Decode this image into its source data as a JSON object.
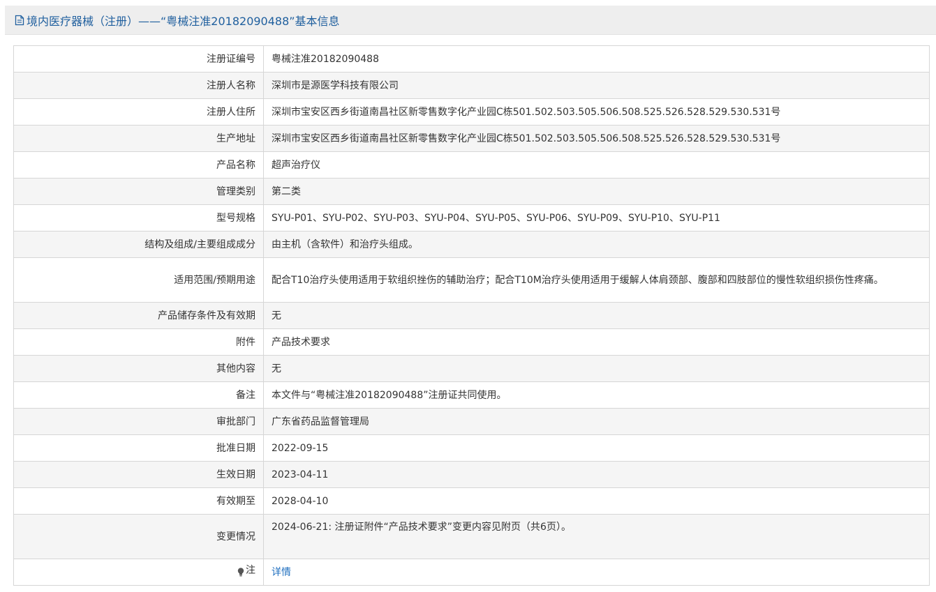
{
  "header": {
    "title": "境内医疗器械（注册）——“粤械注准20182090488”基本信息",
    "icon": "document-icon",
    "title_color": "#1f5f9e"
  },
  "rows": [
    {
      "label": "注册证编号",
      "value": "粤械注准20182090488"
    },
    {
      "label": "注册人名称",
      "value": "深圳市是源医学科技有限公司"
    },
    {
      "label": "注册人住所",
      "value": "深圳市宝安区西乡街道南昌社区新零售数字化产业园C栋501.502.503.505.506.508.525.526.528.529.530.531号"
    },
    {
      "label": "生产地址",
      "value": "深圳市宝安区西乡街道南昌社区新零售数字化产业园C栋501.502.503.505.506.508.525.526.528.529.530.531号"
    },
    {
      "label": "产品名称",
      "value": "超声治疗仪"
    },
    {
      "label": "管理类别",
      "value": "第二类"
    },
    {
      "label": "型号规格",
      "value": "SYU-P01、SYU-P02、SYU-P03、SYU-P04、SYU-P05、SYU-P06、SYU-P09、SYU-P10、SYU-P11"
    },
    {
      "label": "结构及组成/主要组成成分",
      "value": "由主机（含软件）和治疗头组成。"
    },
    {
      "label": "适用范围/预期用途",
      "value": "配合T10治疗头使用适用于软组织挫伤的辅助治疗；配合T10M治疗头使用适用于缓解人体肩颈部、腹部和四肢部位的慢性软组织损伤性疼痛。"
    },
    {
      "label": "产品储存条件及有效期",
      "value": "无"
    },
    {
      "label": "附件",
      "value": "产品技术要求"
    },
    {
      "label": "其他内容",
      "value": "无"
    },
    {
      "label": "备注",
      "value": "本文件与“粤械注准20182090488”注册证共同使用。"
    },
    {
      "label": "审批部门",
      "value": "广东省药品监督管理局"
    },
    {
      "label": "批准日期",
      "value": "2022-09-15"
    },
    {
      "label": "生效日期",
      "value": "2023-04-11"
    },
    {
      "label": "有效期至",
      "value": "2028-04-10"
    },
    {
      "label": "变更情况",
      "value": "2024-06-21: 注册证附件“产品技术要求”变更内容见附页（共6页）。"
    }
  ],
  "note": {
    "label": "注",
    "icon": "lightbulb-icon",
    "link_text": "详情",
    "link_color": "#1f6fbf"
  }
}
